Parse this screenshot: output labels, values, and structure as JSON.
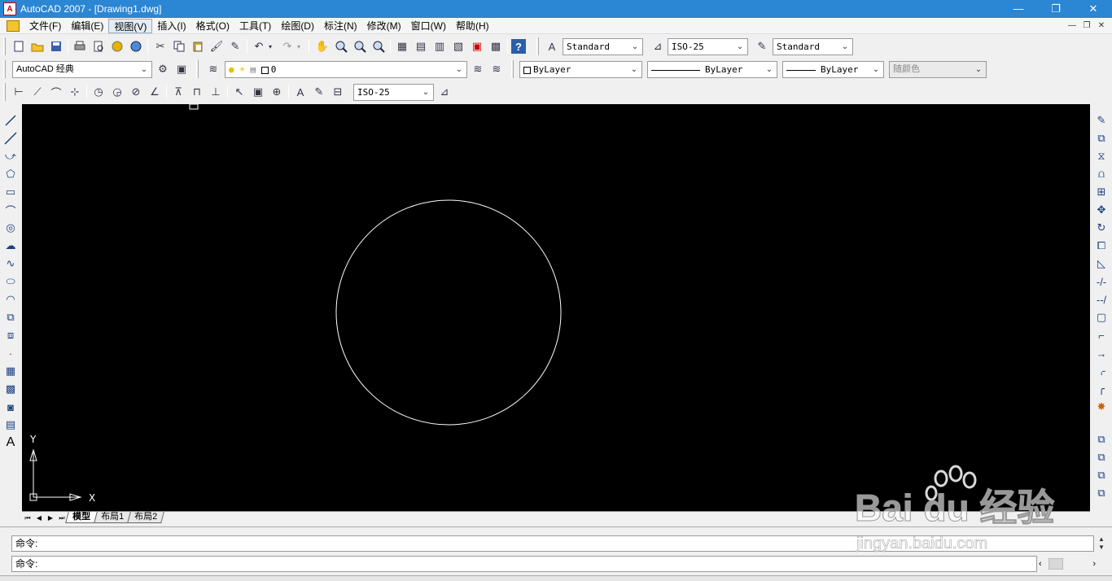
{
  "window": {
    "title": "AutoCAD 2007 - [Drawing1.dwg]",
    "minimize": "—",
    "maximize": "❐",
    "close": "✕"
  },
  "menu": {
    "items": [
      "文件(F)",
      "编辑(E)",
      "视图(V)",
      "插入(I)",
      "格式(O)",
      "工具(T)",
      "绘图(D)",
      "标注(N)",
      "修改(M)",
      "窗口(W)",
      "帮助(H)"
    ],
    "active_index": 2
  },
  "toolbar": {
    "text_style": "Standard",
    "dim_style": "ISO-25",
    "table_style": "Standard",
    "workspace": "AutoCAD 经典",
    "layer": "0",
    "color": "ByLayer",
    "linetype": "ByLayer",
    "lineweight": "ByLayer",
    "plot_style": "随颜色",
    "dim_style_2": "ISO-25"
  },
  "canvas": {
    "background": "#000000",
    "entity_color": "#ffffff",
    "ucs_x_label": "X",
    "ucs_y_label": "Y"
  },
  "tabs": {
    "items": [
      "模型",
      "布局1",
      "布局2"
    ],
    "active_index": 0
  },
  "command": {
    "history_line": "命令:",
    "prompt_line": "命令:"
  },
  "watermark": {
    "brand": "Bai du 经验",
    "url": "jingyan.baidu.com"
  }
}
